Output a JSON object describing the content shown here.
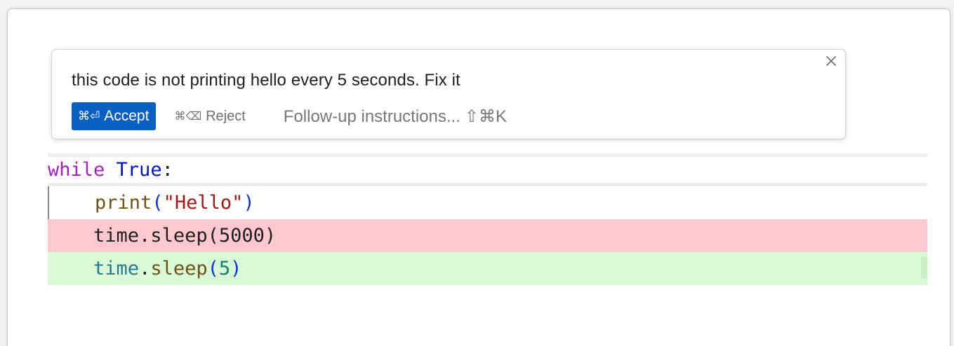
{
  "prompt": {
    "text": "this code is not printing hello every 5 seconds. Fix it",
    "close_symbol": "×",
    "accept": {
      "shortcut": "⌘⏎",
      "label": "Accept"
    },
    "reject": {
      "shortcut": "⌘⌫",
      "label": "Reject"
    },
    "followup": {
      "placeholder": "Follow-up instructions...",
      "shortcut": "⇧⌘K"
    }
  },
  "code": {
    "line1": {
      "keyword": "while",
      "space": " ",
      "value": "True",
      "colon": ":"
    },
    "line2": {
      "indent": "    ",
      "fn": "print",
      "open": "(",
      "arg": "\"Hello\"",
      "close": ")"
    },
    "removed_line": {
      "indent": "    ",
      "text": "time.sleep(5000)"
    },
    "added_line": {
      "indent": "    ",
      "obj": "time",
      "dot": ".",
      "fn": "sleep",
      "open": "(",
      "arg": "5",
      "close": ")"
    }
  },
  "colors": {
    "accept_bg": "#0a60c2",
    "removed_bg": "#ffc8cf",
    "added_bg": "#d9f8d6"
  }
}
